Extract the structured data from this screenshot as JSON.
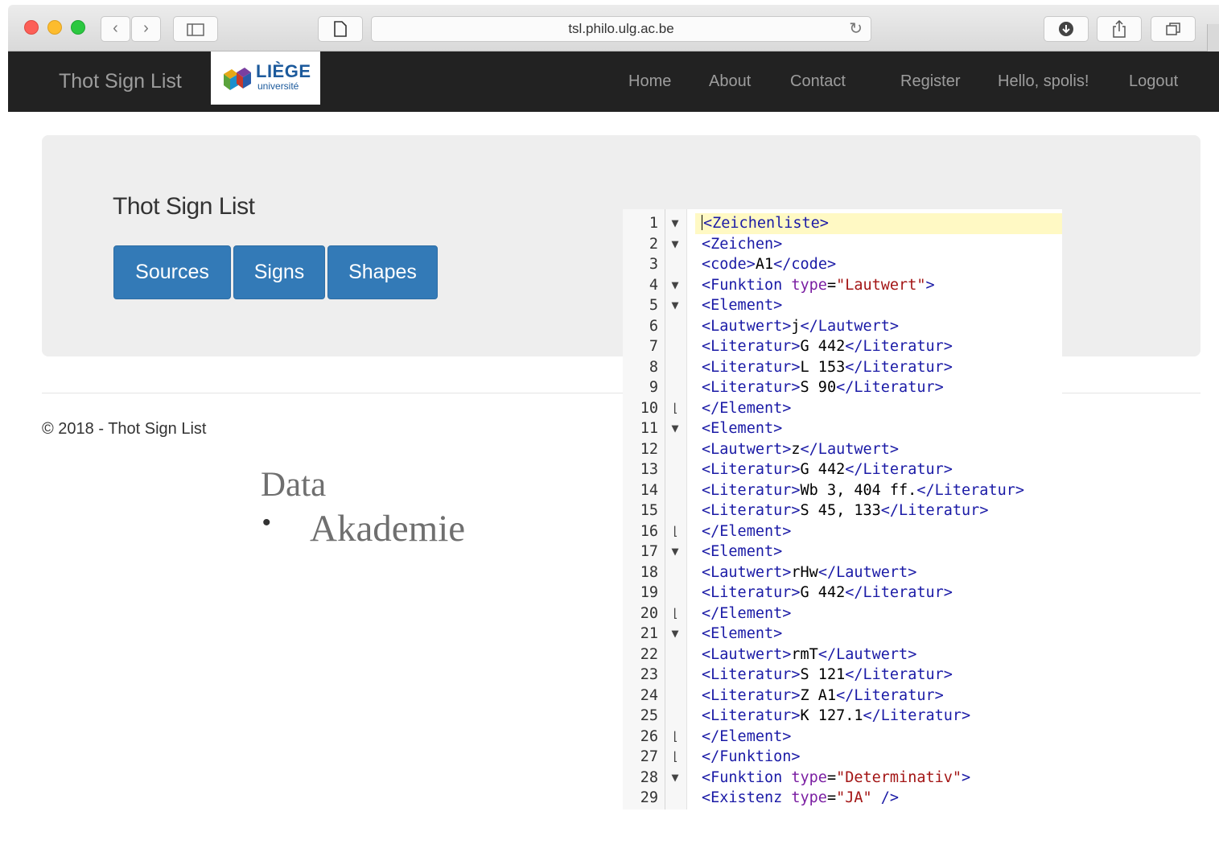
{
  "browser": {
    "url": "tsl.philo.ulg.ac.be",
    "icons": {
      "back": "chevron-left-icon",
      "forward": "chevron-right-icon",
      "sidebar": "sidebar-icon",
      "page": "page-icon",
      "reload": "reload-icon",
      "download": "download-icon",
      "share": "share-icon",
      "tabs": "tabs-icon"
    }
  },
  "navbar": {
    "brand": "Thot Sign List",
    "logo": {
      "title": "LIÈGE",
      "subtitle": "université"
    },
    "links": [
      "Home",
      "About",
      "Contact",
      "Register",
      "Hello, spolis!",
      "Logout"
    ]
  },
  "jumbotron": {
    "title": "Thot Sign List",
    "buttons": [
      "Sources",
      "Signs",
      "Shapes"
    ]
  },
  "footer": {
    "text": "© 2018 - Thot Sign List"
  },
  "data_section": {
    "title": "Data",
    "items": [
      "Akademie"
    ]
  },
  "editor": {
    "colors": {
      "tag": "#1a1aa6",
      "attribute": "#7b1fa2",
      "value": "#a31515",
      "active_line": "#fff9c4"
    },
    "lines": [
      {
        "n": "1",
        "fold": "▼",
        "code": "<Zeichenliste>"
      },
      {
        "n": "2",
        "fold": "▼",
        "code": "<Zeichen>"
      },
      {
        "n": "3",
        "fold": "",
        "code": "<code>A1</code>"
      },
      {
        "n": "4",
        "fold": "▼",
        "code": "<Funktion type=\"Lautwert\">"
      },
      {
        "n": "5",
        "fold": "▼",
        "code": "<Element>"
      },
      {
        "n": "6",
        "fold": "",
        "code": "<Lautwert>j</Lautwert>"
      },
      {
        "n": "7",
        "fold": "",
        "code": "<Literatur>G 442</Literatur>"
      },
      {
        "n": "8",
        "fold": "",
        "code": "<Literatur>L 153</Literatur>"
      },
      {
        "n": "9",
        "fold": "",
        "code": "<Literatur>S 90</Literatur>"
      },
      {
        "n": "10",
        "fold": "⌊",
        "code": "</Element>"
      },
      {
        "n": "11",
        "fold": "▼",
        "code": "<Element>"
      },
      {
        "n": "12",
        "fold": "",
        "code": "<Lautwert>z</Lautwert>"
      },
      {
        "n": "13",
        "fold": "",
        "code": "<Literatur>G 442</Literatur>"
      },
      {
        "n": "14",
        "fold": "",
        "code": "<Literatur>Wb 3, 404 ff.</Literatur>"
      },
      {
        "n": "15",
        "fold": "",
        "code": "<Literatur>S 45, 133</Literatur>"
      },
      {
        "n": "16",
        "fold": "⌊",
        "code": "</Element>"
      },
      {
        "n": "17",
        "fold": "▼",
        "code": "<Element>"
      },
      {
        "n": "18",
        "fold": "",
        "code": "<Lautwert>rHw</Lautwert>"
      },
      {
        "n": "19",
        "fold": "",
        "code": "<Literatur>G 442</Literatur>"
      },
      {
        "n": "20",
        "fold": "⌊",
        "code": "</Element>"
      },
      {
        "n": "21",
        "fold": "▼",
        "code": "<Element>"
      },
      {
        "n": "22",
        "fold": "",
        "code": "<Lautwert>rmT</Lautwert>"
      },
      {
        "n": "23",
        "fold": "",
        "code": "<Literatur>S 121</Literatur>"
      },
      {
        "n": "24",
        "fold": "",
        "code": "<Literatur>Z A1</Literatur>"
      },
      {
        "n": "25",
        "fold": "",
        "code": "<Literatur>K 127.1</Literatur>"
      },
      {
        "n": "26",
        "fold": "⌊",
        "code": "</Element>"
      },
      {
        "n": "27",
        "fold": "⌊",
        "code": "</Funktion>"
      },
      {
        "n": "28",
        "fold": "▼",
        "code": "<Funktion type=\"Determinativ\">"
      },
      {
        "n": "29",
        "fold": "",
        "code": "<Existenz type=\"JA\" />"
      }
    ]
  }
}
